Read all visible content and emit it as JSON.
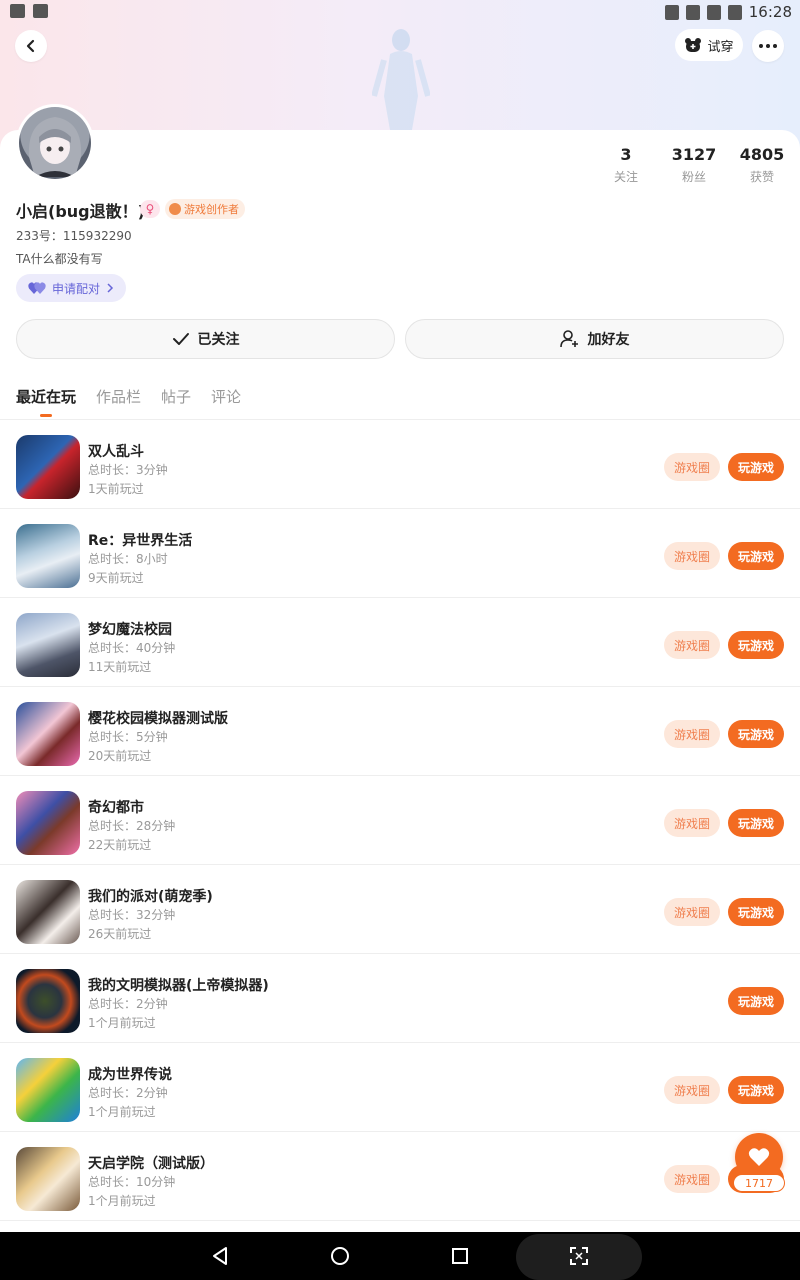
{
  "status_bar": {
    "time": "16:28"
  },
  "header": {
    "try_on_label": "试穿"
  },
  "profile": {
    "name": "小启(bug退散！)",
    "gender_symbol": "♀",
    "creator_badge": "游戏创作者",
    "uid": "233号：115932290",
    "bio": "TA什么都没有写",
    "pair_label": "申请配对",
    "stats": [
      {
        "value": "3",
        "label": "关注"
      },
      {
        "value": "3127",
        "label": "粉丝"
      },
      {
        "value": "4805",
        "label": "获赞"
      }
    ],
    "follow_label": "已关注",
    "add_friend_label": "加好友"
  },
  "tabs": [
    {
      "label": "最近在玩",
      "active": true
    },
    {
      "label": "作品栏",
      "active": false
    },
    {
      "label": "帖子",
      "active": false
    },
    {
      "label": "评论",
      "active": false
    }
  ],
  "games": [
    {
      "title": "双人乱斗",
      "duration": "总时长：3分钟",
      "last_played": "1天前玩过",
      "has_circle": true,
      "circle_label": "游戏圈",
      "play_label": "玩游戏"
    },
    {
      "title": "Re：异世界生活",
      "duration": "总时长：8小时",
      "last_played": "9天前玩过",
      "has_circle": true,
      "circle_label": "游戏圈",
      "play_label": "玩游戏"
    },
    {
      "title": "梦幻魔法校园",
      "duration": "总时长：40分钟",
      "last_played": "11天前玩过",
      "has_circle": true,
      "circle_label": "游戏圈",
      "play_label": "玩游戏"
    },
    {
      "title": "樱花校园模拟器测试版",
      "duration": "总时长：5分钟",
      "last_played": "20天前玩过",
      "has_circle": true,
      "circle_label": "游戏圈",
      "play_label": "玩游戏"
    },
    {
      "title": "奇幻都市",
      "duration": "总时长：28分钟",
      "last_played": "22天前玩过",
      "has_circle": true,
      "circle_label": "游戏圈",
      "play_label": "玩游戏"
    },
    {
      "title": "我们的派对(萌宠季)",
      "duration": "总时长：32分钟",
      "last_played": "26天前玩过",
      "has_circle": true,
      "circle_label": "游戏圈",
      "play_label": "玩游戏"
    },
    {
      "title": "我的文明模拟器(上帝模拟器)",
      "duration": "总时长：2分钟",
      "last_played": "1个月前玩过",
      "has_circle": false,
      "circle_label": "",
      "play_label": "玩游戏"
    },
    {
      "title": "成为世界传说",
      "duration": "总时长：2分钟",
      "last_played": "1个月前玩过",
      "has_circle": true,
      "circle_label": "游戏圈",
      "play_label": "玩游戏"
    },
    {
      "title": "天启学院（测试版）",
      "duration": "总时长：10分钟",
      "last_played": "1个月前玩过",
      "has_circle": true,
      "circle_label": "游戏圈",
      "play_label": ""
    }
  ],
  "like": {
    "count": "1717"
  },
  "colors": {
    "accent": "#f36b21",
    "accent_light": "#fde7da",
    "pair_purple": "#6766d8"
  },
  "icons": [
    "back-icon",
    "more-icon",
    "bear-icon",
    "check-icon",
    "add-user-icon",
    "heart-icon",
    "chevron-right-icon",
    "nav-back-icon",
    "nav-home-icon",
    "nav-recents-icon",
    "nav-screenshot-icon"
  ]
}
